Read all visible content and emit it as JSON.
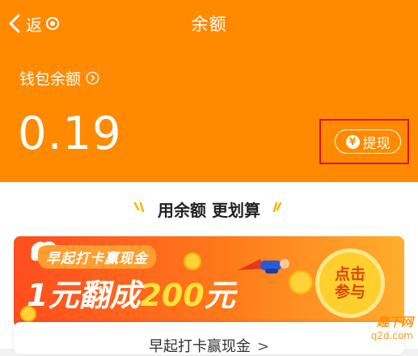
{
  "header": {
    "back_label": "返",
    "title": "余额",
    "wallet_label": "钱包余额",
    "balance": "0.19",
    "withdraw_icon_glyph": "¥",
    "withdraw_label": "提现",
    "accent": "#ff8a00",
    "highlight_color": "#e0101a"
  },
  "promo": {
    "slogan": "用余额 更划算",
    "banner_top": "早起打卡赢现金",
    "banner_amount_prefix": "1元翻成",
    "banner_amount_value": "200",
    "banner_amount_suffix": "元",
    "join_line1": "点击",
    "join_line2": "参与",
    "card_label": "早起打卡赢现金",
    "card_chevron": ">"
  },
  "watermark": {
    "top": "趣下网",
    "bottom": "q2d.com"
  },
  "icons": [
    "back-chevron-icon",
    "target-icon",
    "info-chevron-icon",
    "yen-icon",
    "sparkle-icon",
    "egg-icon",
    "flying-man-icon",
    "coin-icon"
  ]
}
